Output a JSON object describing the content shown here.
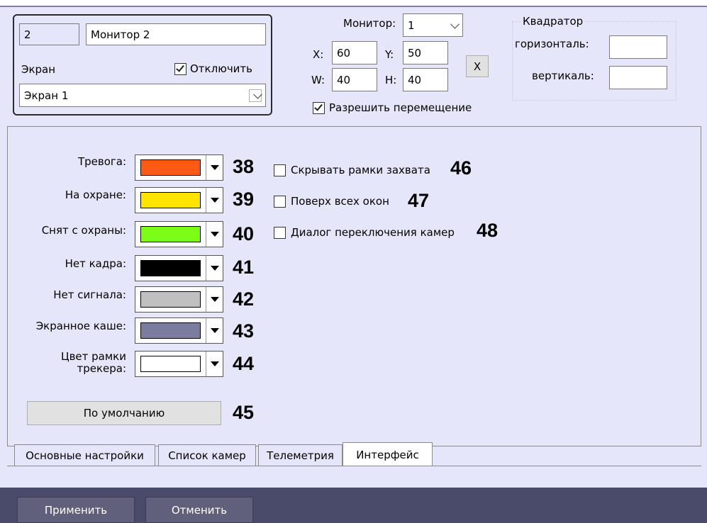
{
  "monitor": {
    "id_value": "2",
    "name_value": "Монитор 2",
    "screen_label": "Экран",
    "disable_label": "Отключить",
    "disable_checked": true,
    "screen_select_value": "Экран 1"
  },
  "position": {
    "monitor_label": "Монитор:",
    "monitor_value": "1",
    "x_label": "X:",
    "x_value": "60",
    "y_label": "Y:",
    "y_value": "50",
    "w_label": "W:",
    "w_value": "40",
    "h_label": "H:",
    "h_value": "40",
    "reset_button": "X",
    "allow_move_label": "Разрешить перемещение",
    "allow_move_checked": true
  },
  "quad": {
    "title": "Квадратор",
    "horizontal_label": "горизонталь:",
    "horizontal_value": "",
    "vertical_label": "вертикаль:",
    "vertical_value": ""
  },
  "colors": [
    {
      "label": "Тревога:",
      "color": "#ff5a14",
      "callout": "38"
    },
    {
      "label": "На охране:",
      "color": "#ffe400",
      "callout": "39"
    },
    {
      "label": "Снят с охраны:",
      "color": "#7dfc18",
      "callout": "40"
    },
    {
      "label": "Нет кадра:",
      "color": "#000000",
      "callout": "41"
    },
    {
      "label": "Нет сигнала:",
      "color": "#c0c0c0",
      "callout": "42"
    },
    {
      "label": "Экранное каше:",
      "color": "#7c7ca0",
      "callout": "43"
    },
    {
      "label": "Цвет рамки трекера:",
      "label_line1": "Цвет рамки",
      "label_line2": "трекера:",
      "color": "#ffffff",
      "callout": "44"
    }
  ],
  "default_button": "По умолчанию",
  "default_callout": "45",
  "options": [
    {
      "label": "Скрывать рамки захвата",
      "checked": false,
      "callout": "46"
    },
    {
      "label": "Поверх всех окон",
      "checked": false,
      "callout": "47"
    },
    {
      "label": "Диалог переключения камер",
      "checked": false,
      "callout": "48"
    }
  ],
  "tabs": [
    {
      "label": "Основные настройки",
      "active": false
    },
    {
      "label": "Список камер",
      "active": false
    },
    {
      "label": "Телеметрия",
      "active": false
    },
    {
      "label": "Интерфейс",
      "active": true
    }
  ],
  "footer": {
    "apply_button": "Применить",
    "cancel_button": "Отменить"
  }
}
